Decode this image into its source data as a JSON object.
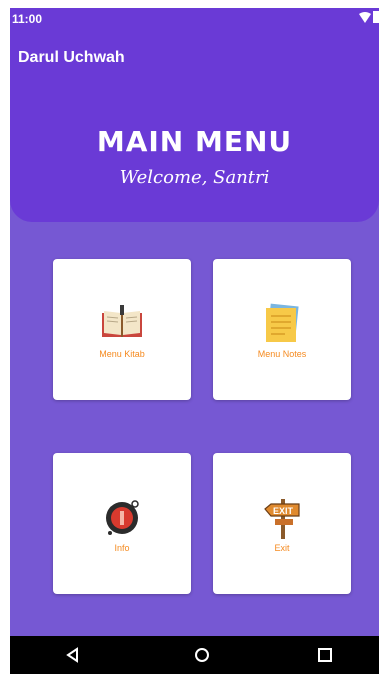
{
  "status": {
    "time": "11:00"
  },
  "appbar": {
    "title": "Darul Uchwah"
  },
  "header": {
    "title": "MAIN MENU",
    "subtitle": "Welcome, Santri"
  },
  "menu": [
    {
      "label": "Menu Kitab",
      "icon": "book-icon"
    },
    {
      "label": "Menu Notes",
      "icon": "notes-icon"
    },
    {
      "label": "Info",
      "icon": "info-icon"
    },
    {
      "label": "Exit",
      "icon": "exit-sign-icon"
    }
  ],
  "colors": {
    "primary": "#6a3ad6",
    "background": "#7658d3",
    "label": "#f58a1f"
  }
}
